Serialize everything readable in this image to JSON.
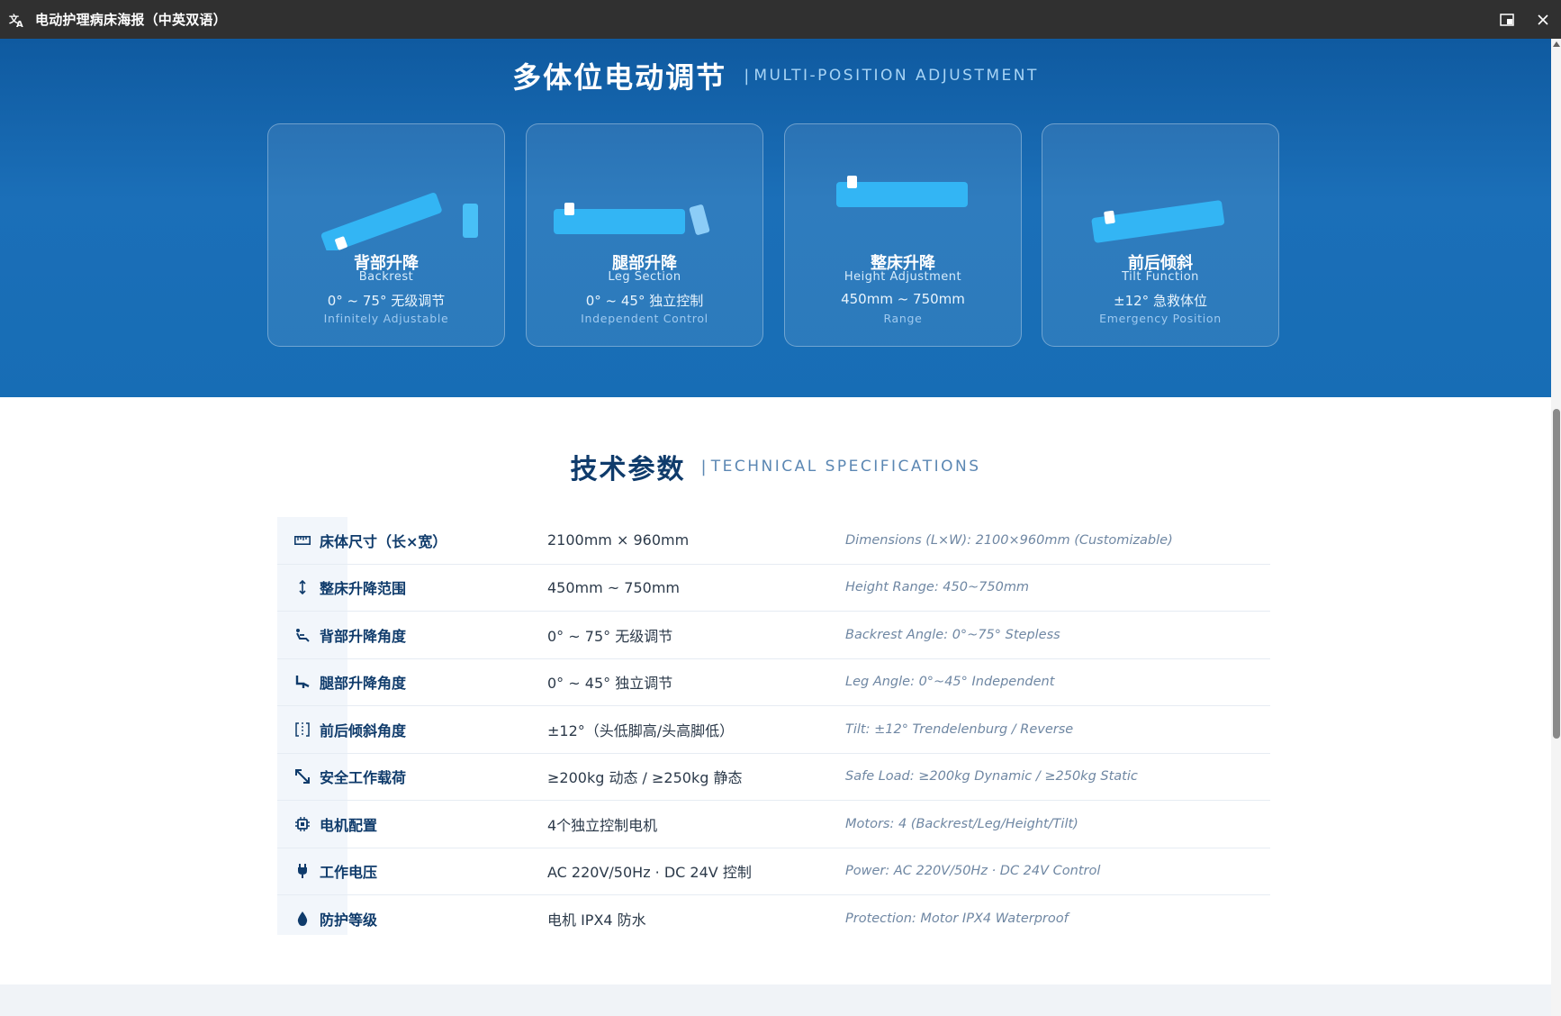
{
  "window": {
    "title": "电动护理病床海报（中英双语）",
    "app_icon": "translate-icon",
    "controls": [
      "picture-in-picture-icon",
      "close-icon"
    ]
  },
  "hero": {
    "title_zh": "多体位电动调节",
    "separator": "|",
    "title_en": "MULTI-POSITION ADJUSTMENT",
    "cards": [
      {
        "zh": "背部升降",
        "en": "Backrest",
        "value": "0° ~ 75° 无级调节",
        "note": "Infinitely Adjustable",
        "icon": "backrest-bed-icon"
      },
      {
        "zh": "腿部升降",
        "en": "Leg Section",
        "value": "0° ~ 45° 独立控制",
        "note": "Independent Control",
        "icon": "leg-section-bed-icon"
      },
      {
        "zh": "整床升降",
        "en": "Height Adjustment",
        "value": "450mm ~ 750mm",
        "note": "Range",
        "icon": "height-bed-icon"
      },
      {
        "zh": "前后倾斜",
        "en": "Tilt Function",
        "value": "±12° 急救体位",
        "note": "Emergency Position",
        "icon": "tilt-bed-icon"
      }
    ]
  },
  "specs": {
    "title_zh": "技术参数",
    "separator": "|",
    "title_en": "TECHNICAL SPECIFICATIONS",
    "rows": [
      {
        "icon": "ruler-icon",
        "label": "床体尺寸（长×宽）",
        "value": "2100mm × 960mm",
        "en": "Dimensions (L×W): 2100×960mm (Customizable)"
      },
      {
        "icon": "vertical-arrows-icon",
        "label": "整床升降范围",
        "value": "450mm ~ 750mm",
        "en": "Height Range: 450~750mm"
      },
      {
        "icon": "reclining-seat-icon",
        "label": "背部升降角度",
        "value": "0° ~ 75° 无级调节",
        "en": "Backrest Angle: 0°~75° Stepless"
      },
      {
        "icon": "leg-rest-icon",
        "label": "腿部升降角度",
        "value": "0° ~ 45° 独立调节",
        "en": "Leg Angle: 0°~45° Independent"
      },
      {
        "icon": "tilt-frame-icon",
        "label": "前后倾斜角度",
        "value": "±12°（头低脚高/头高脚低）",
        "en": "Tilt: ±12° Trendelenburg / Reverse"
      },
      {
        "icon": "load-arrows-icon",
        "label": "安全工作载荷",
        "value": "≥200kg 动态 / ≥250kg 静态",
        "en": "Safe Load: ≥200kg Dynamic / ≥250kg Static"
      },
      {
        "icon": "chip-icon",
        "label": "电机配置",
        "value": "4个独立控制电机",
        "en": "Motors: 4 (Backrest/Leg/Height/Tilt)"
      },
      {
        "icon": "plug-icon",
        "label": "工作电压",
        "value": "AC 220V/50Hz · DC 24V 控制",
        "en": "Power: AC 220V/50Hz · DC 24V Control"
      },
      {
        "icon": "water-drop-icon",
        "label": "防护等级",
        "value": "电机 IPX4 防水",
        "en": "Protection: Motor IPX4 Waterproof"
      }
    ]
  },
  "colors": {
    "hero_bg": "#1b6fb8",
    "bed_blue": "#33b5f4",
    "heading_dark": "#0f3b6b",
    "titlebar": "#303030"
  }
}
